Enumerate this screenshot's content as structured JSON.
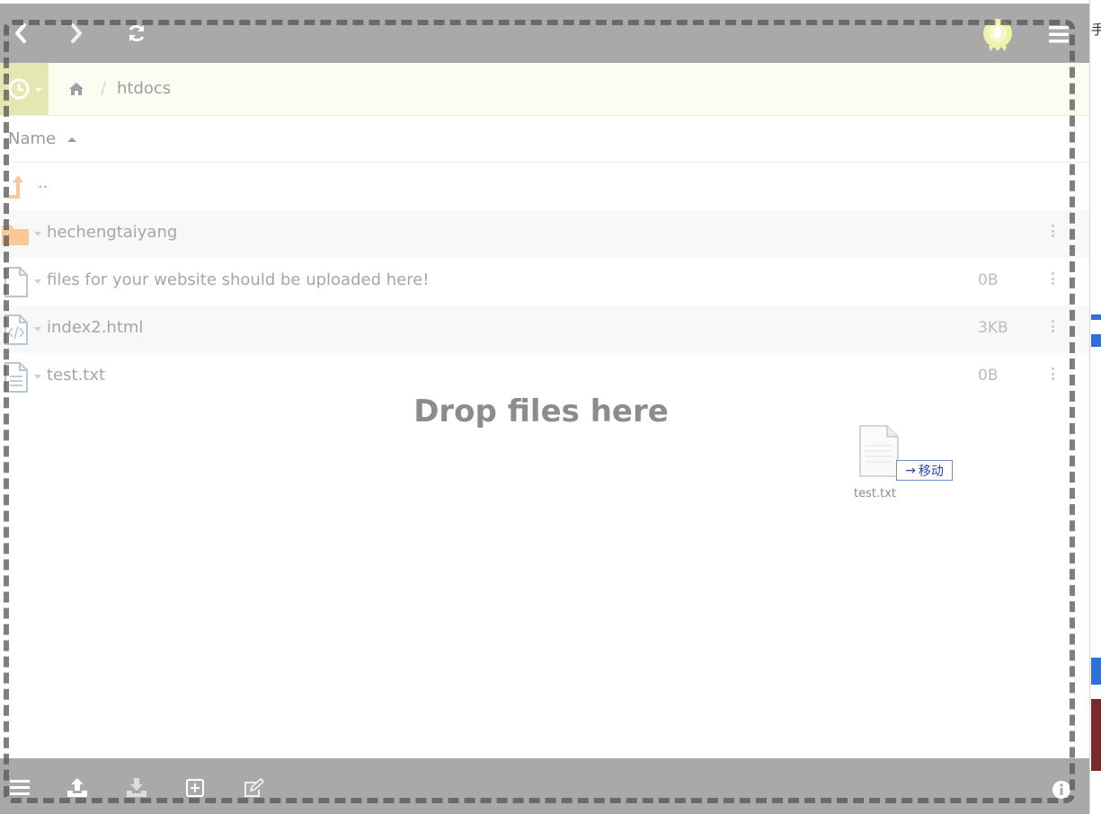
{
  "toolbar": {
    "back_icon": "chevron-left-icon",
    "forward_icon": "chevron-right-icon",
    "refresh_icon": "refresh-icon",
    "menu_icon": "hamburger-icon"
  },
  "breadcrumb": {
    "home_icon": "home-icon",
    "separator": "/",
    "current": "htdocs"
  },
  "list": {
    "header": {
      "name_label": "Name"
    },
    "parent": "..",
    "rows": [
      {
        "name": "hechengtaiyang",
        "size": "",
        "icon": "folder-icon"
      },
      {
        "name": "files for your website should be uploaded here!",
        "size": "0B",
        "icon": "file-icon"
      },
      {
        "name": "index2.html",
        "size": "3KB",
        "icon": "code-file-icon"
      },
      {
        "name": "test.txt",
        "size": "0B",
        "icon": "text-file-icon"
      }
    ]
  },
  "dropzone": {
    "text": "Drop files here"
  },
  "drag": {
    "move_label": "移动",
    "filename": "test.txt"
  },
  "bottombar": {
    "icons": [
      "menu-icon",
      "upload-icon",
      "download-icon",
      "new-folder-icon",
      "edit-icon",
      "info-icon"
    ]
  },
  "side": {
    "fragment": "手"
  },
  "colors": {
    "toolbar": "#a9a9a9",
    "breadcrumb_bg": "#fbfdf0",
    "history_bg": "#e5e7b2",
    "folder": "#f8c996"
  }
}
